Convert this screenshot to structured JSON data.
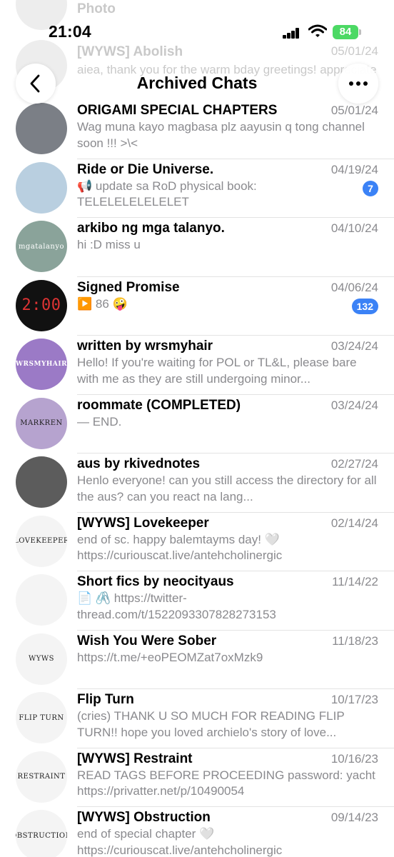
{
  "status": {
    "time": "21:04",
    "battery": "84"
  },
  "background_rows": [
    {
      "title": "Photo",
      "date": ""
    },
    {
      "title": "[WYWS] Abolish",
      "date": "05/01/24",
      "preview": "aiea, thank you for the warm bday greetings! appreciate it! here's the special ch..."
    }
  ],
  "header": {
    "title": "Archived Chats"
  },
  "chats": [
    {
      "title": "ORIGAMI SPECIAL CHAPTERS",
      "date": "05/01/24",
      "preview": "Wag muna kayo magbasa plz aayusin q tong channel soon !!! >\\<",
      "badge": "",
      "avatar_color": "#7b7f86",
      "avatar_text": ""
    },
    {
      "title": "Ride or Die Universe.",
      "date": "04/19/24",
      "preview": "📢 update sa RoD physical book: TELELELELELELET",
      "badge": "7",
      "avatar_color": "#b9cfe0",
      "avatar_text": ""
    },
    {
      "title": "arkibo ng mga talanyo.",
      "date": "04/10/24",
      "preview": "hi :D miss u",
      "badge": "",
      "avatar_color": "#8aa39a",
      "avatar_text": "mgatalanyo"
    },
    {
      "title": "Signed Promise",
      "date": "04/06/24",
      "preview": "▶️ 86 🤪",
      "badge": "132",
      "avatar_color": "#111111",
      "avatar_text": "2:00"
    },
    {
      "title": "written by wrsmyhair",
      "date": "03/24/24",
      "preview": "Hello! If you're waiting for POL or TL&L, please bare with me as they are still undergoing minor...",
      "badge": "",
      "avatar_color": "#9b7ac6",
      "avatar_text": "WRSMYHAIR"
    },
    {
      "title": "roommate (COMPLETED)",
      "date": "03/24/24",
      "preview": "— END.",
      "badge": "",
      "avatar_color": "#b6a3cf",
      "avatar_text": "MARKREN"
    },
    {
      "title": "aus by rkivednotes",
      "date": "02/27/24",
      "preview": "Henlo everyone! can you still access the directory for all the aus? can you react na lang...",
      "badge": "",
      "avatar_color": "#5c5c5c",
      "avatar_text": ""
    },
    {
      "title": "[WYWS] Lovekeeper",
      "date": "02/14/24",
      "preview": "end of sc. happy balemtayms day! 🤍 https://curiouscat.live/antehcholinergic",
      "badge": "",
      "avatar_color": "#f4f4f4",
      "avatar_text": "LOVEKEEPER"
    },
    {
      "title": "Short fics by neocityaus",
      "date": "11/14/22",
      "preview": "📄 🖇️ https://twitter-thread.com/t/1522093307828273153",
      "badge": "",
      "avatar_color": "#f4f4f4",
      "avatar_text": ""
    },
    {
      "title": "Wish You Were Sober",
      "date": "11/18/23",
      "preview": "https://t.me/+eoPEOMZat7oxMzk9",
      "badge": "",
      "avatar_color": "#f4f4f4",
      "avatar_text": "WYWS"
    },
    {
      "title": "Flip Turn",
      "date": "10/17/23",
      "preview": "(cries) THANK U SO MUCH FOR READING FLIP TURN!! hope you loved archielo's story of love...",
      "badge": "",
      "avatar_color": "#f4f4f4",
      "avatar_text": "FLIP TURN"
    },
    {
      "title": "[WYWS] Restraint",
      "date": "10/16/23",
      "preview": "READ TAGS BEFORE PROCEEDING password: yacht https://privatter.net/p/10490054",
      "badge": "",
      "avatar_color": "#f4f4f4",
      "avatar_text": "RESTRAINT"
    },
    {
      "title": "[WYWS] Obstruction",
      "date": "09/14/23",
      "preview": "end of special chapter 🤍 https://curiouscat.live/antehcholinergic",
      "badge": "",
      "avatar_color": "#f4f4f4",
      "avatar_text": "OBSTRUCTION"
    }
  ]
}
